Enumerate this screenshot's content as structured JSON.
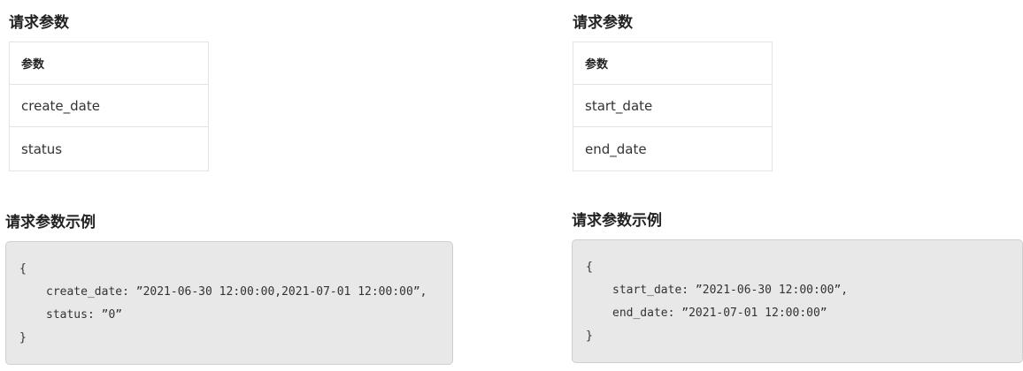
{
  "left": {
    "params_heading": "请求参数",
    "table_header": "参数",
    "params": [
      "create_date",
      "status"
    ],
    "example_heading": "请求参数示例",
    "code_lines": [
      "{",
      "create_date: ”2021-06-30 12:00:00,2021-07-01 12:00:00”,",
      "status: ”0”",
      "}"
    ]
  },
  "right": {
    "params_heading": "请求参数",
    "table_header": "参数",
    "params": [
      "start_date",
      "end_date"
    ],
    "example_heading": "请求参数示例",
    "code_lines": [
      "{",
      "start_date: ”2021-06-30 12:00:00”,",
      "end_date: ”2021-07-01 12:00:00”",
      "}"
    ]
  }
}
